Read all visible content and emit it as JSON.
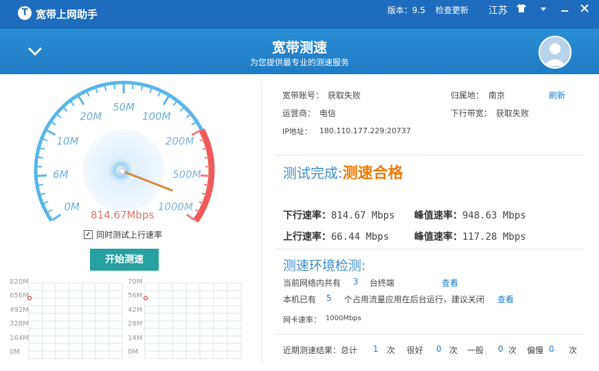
{
  "app": {
    "title": "宽带上网助手",
    "logo_icon": "broadband-logo-icon"
  },
  "titlebar": {
    "version_label": "版本：9.5",
    "update_label": "检查更新",
    "region": "江苏",
    "skin_icon": "tshirt-icon",
    "menu_icon": "chevron-down-icon",
    "minimize_icon": "minimize-icon",
    "close_icon": "close-icon"
  },
  "banner": {
    "title": "宽带测速",
    "subtitle": "为您提供最专业的测速服务",
    "collapse_icon": "chevron-down-icon",
    "avatar_icon": "user-avatar-icon"
  },
  "gauge": {
    "ticks": [
      "0M",
      "6M",
      "10M",
      "20M",
      "50M",
      "100M",
      "200M",
      "500M",
      "1000M"
    ],
    "readout": "814.67Mbps",
    "needle_fraction": 0.95
  },
  "options": {
    "upload_test_label": "同时测试上行速率",
    "upload_test_checked": true
  },
  "start_button": "开始测速",
  "mini_charts": {
    "download_axis": [
      "820M",
      "656M",
      "492M",
      "328M",
      "164M",
      "0M"
    ],
    "upload_axis": [
      "70M",
      "56M",
      "42M",
      "28M",
      "14M",
      "0M"
    ]
  },
  "account": {
    "account_label": "宽带账号：",
    "account_value": "获取失败",
    "location_label": "归属地：",
    "location_value": "南京",
    "refresh_label": "刷新",
    "isp_label": "运营商：",
    "isp_value": "电信",
    "bandwidth_label": "下行带宽：",
    "bandwidth_value": "获取失败",
    "ip_label": "IP地址：",
    "ip_value": "180.110.177.229:20737"
  },
  "result": {
    "prefix": "测试完成:",
    "verdict": "测速合格",
    "down_label": "下行速率：",
    "down_value": "814.67 Mbps",
    "down_peak_label": "峰值速率：",
    "down_peak_value": "948.63 Mbps",
    "up_label": "上行速率：",
    "up_value": "66.44 Mbps",
    "up_peak_label": "峰值速率：",
    "up_peak_value": "117.28 Mbps"
  },
  "environment": {
    "title": "测速环境检测:",
    "net_prefix": "当前网络内共有",
    "net_count": "3",
    "net_suffix": "台终端",
    "net_link": "查看",
    "app_prefix": "本机已有",
    "app_count": "5",
    "app_suffix": "个占用流量应用在后台运行，建议关闭",
    "app_link": "查看",
    "nic_label": "网卡速率：",
    "nic_value": "1000Mbps"
  },
  "history": {
    "label": "近期测速结果：总计",
    "total": "1",
    "unit1": "次",
    "good_label": "很好",
    "good": "0",
    "unit2": "次",
    "normal_label": "一般",
    "normal": "0",
    "unit3": "次",
    "slow_label": "偏慢",
    "slow": "0",
    "unit4": "次"
  }
}
